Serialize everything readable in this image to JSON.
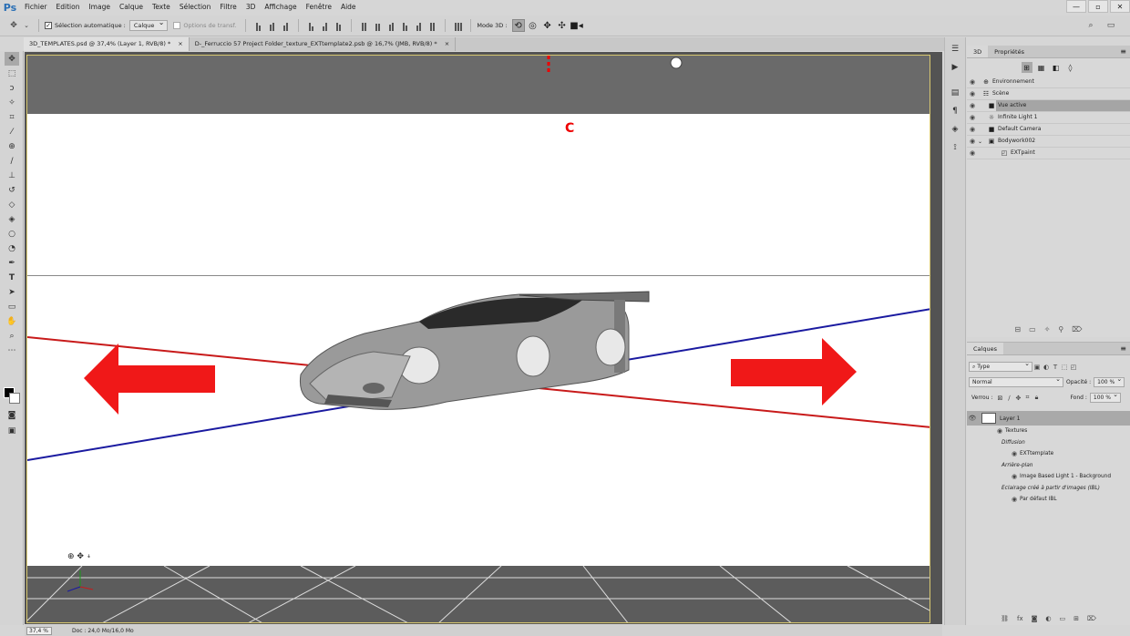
{
  "app": {
    "logo": "Ps"
  },
  "menu": [
    "Fichier",
    "Edition",
    "Image",
    "Calque",
    "Texte",
    "Sélection",
    "Filtre",
    "3D",
    "Affichage",
    "Fenêtre",
    "Aide"
  ],
  "window_controls": [
    "—",
    "▫",
    "✕"
  ],
  "options_bar": {
    "auto_select_label": "Sélection automatique :",
    "auto_select_value": "Calque",
    "transform_options_label": "Options de transf.",
    "mode3d_label": "Mode 3D :"
  },
  "tabs": [
    {
      "label": "3D_TEMPLATES.psd @ 37,4% (Layer 1, RVB/8) *",
      "close": "×"
    },
    {
      "label": "D-_Ferruccio 57 Project Folder_texture_EXTtemplate2.psb @ 16,7% (JMB, RVB/8) *",
      "close": "×"
    }
  ],
  "annotation": {
    "label": "C",
    "color": "#e00000"
  },
  "panel3d": {
    "tabs": [
      "3D",
      "Propriétés"
    ],
    "rows": [
      {
        "label": "Environnement",
        "icon": "globe-icon"
      },
      {
        "label": "Scène",
        "icon": "scene-icon"
      },
      {
        "label": "Vue active",
        "icon": "camera-icon"
      },
      {
        "label": "Infinite Light 1",
        "icon": "light-icon"
      },
      {
        "label": "Default Camera",
        "icon": "camera-icon"
      },
      {
        "label": "Bodywork002",
        "icon": "mesh-icon"
      },
      {
        "label": "EXTpaint",
        "icon": "material-icon"
      }
    ]
  },
  "layers": {
    "title": "Calques",
    "filter_value": "Type",
    "blend_mode": "Normal",
    "opacity_label": "Opacité :",
    "opacity_value": "100 %",
    "lock_label": "Verrou :",
    "fill_label": "Fond :",
    "fill_value": "100 %",
    "layer_name": "Layer 1",
    "sub": [
      {
        "label": "Textures",
        "italic": false,
        "eye": true,
        "indent": 0
      },
      {
        "label": "Diffusion",
        "italic": true,
        "eye": false,
        "indent": 1
      },
      {
        "label": "EXTtemplate",
        "italic": false,
        "eye": true,
        "indent": 2
      },
      {
        "label": "Arrière-plan",
        "italic": true,
        "eye": false,
        "indent": 1
      },
      {
        "label": "Image Based Light 1 - Background",
        "italic": false,
        "eye": true,
        "indent": 2
      },
      {
        "label": "Eclairage créé à partir d'images (IBL)",
        "italic": true,
        "eye": false,
        "indent": 1
      },
      {
        "label": "Par défaut IBL",
        "italic": false,
        "eye": true,
        "indent": 2
      }
    ]
  },
  "status": {
    "zoom": "37,4 %",
    "doc": "Doc : 24,0 Mo/16,0 Mo"
  }
}
